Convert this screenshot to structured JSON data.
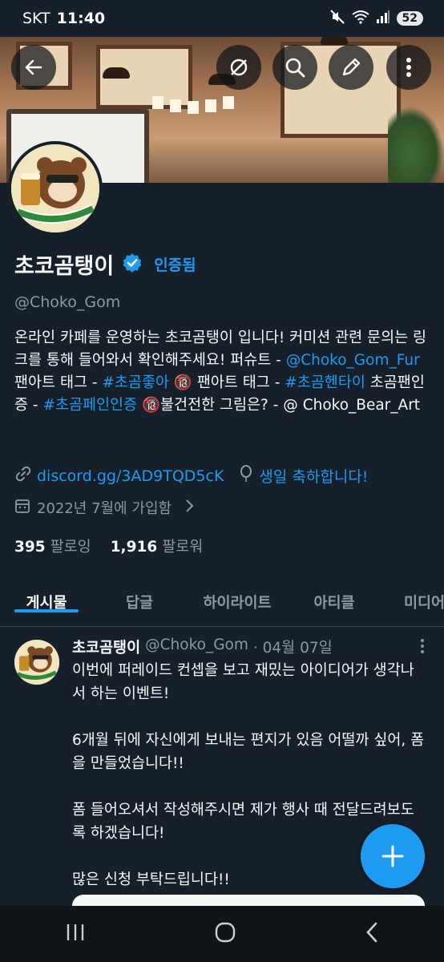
{
  "status": {
    "carrier": "SKT",
    "time": "11:40",
    "battery": "52"
  },
  "profile": {
    "name": "초코곰탱이",
    "verified_label": "인증됨",
    "handle": "@Choko_Gom",
    "bio": {
      "p1": "온라인 카페를 운영하는 초코곰탱이 입니다! 커미션 관련 문의는 링크를 통해 들어와서 확인해주세요!  퍼슈트 - ",
      "link1": "@Choko_Gom_Fur",
      "p2": " 팬아트 태그 - ",
      "link2": "#초곰좋아",
      "p3": " 팬아트 태그 - ",
      "link3": "#초곰헨타이",
      "p4": " 초곰팬인증 - ",
      "link4": "#초곰페인인증",
      "p5": "불건전한 그림은? - @ Choko_Bear_Art",
      "age_badge": "🔞"
    },
    "website": "discord.gg/3AD9TQD5cK",
    "birthday": "생일 축하합니다!",
    "joined": "2022년 7월에 가입함",
    "following_count": "395",
    "following_label": "팔로잉",
    "followers_count": "1,916",
    "followers_label": "팔로워"
  },
  "tabs": [
    {
      "label": "게시물"
    },
    {
      "label": "답글"
    },
    {
      "label": "하이라이트"
    },
    {
      "label": "아티클"
    },
    {
      "label": "미디어"
    }
  ],
  "post": {
    "author": "초코곰탱이",
    "handle": "@Choko_Gom",
    "date": "· 04월 07일",
    "body": "이번에 퍼레이드 컨셉을 보고 재밌는 아이디어가 생각나서 하는 이벤트!\n\n6개월 뒤에 자신에게 보내는 편지가 있음 어떨까 싶어, 폼을 만들었습니다!!\n\n폼 들어오셔서 작성해주시면 제가 행사 때 전달드려보도록 하겠습니다!\n\n많은 신청 부탁드립니다!!"
  },
  "colors": {
    "accent": "#1d9bf0",
    "background": "#15202b",
    "muted": "#8b98a5"
  }
}
